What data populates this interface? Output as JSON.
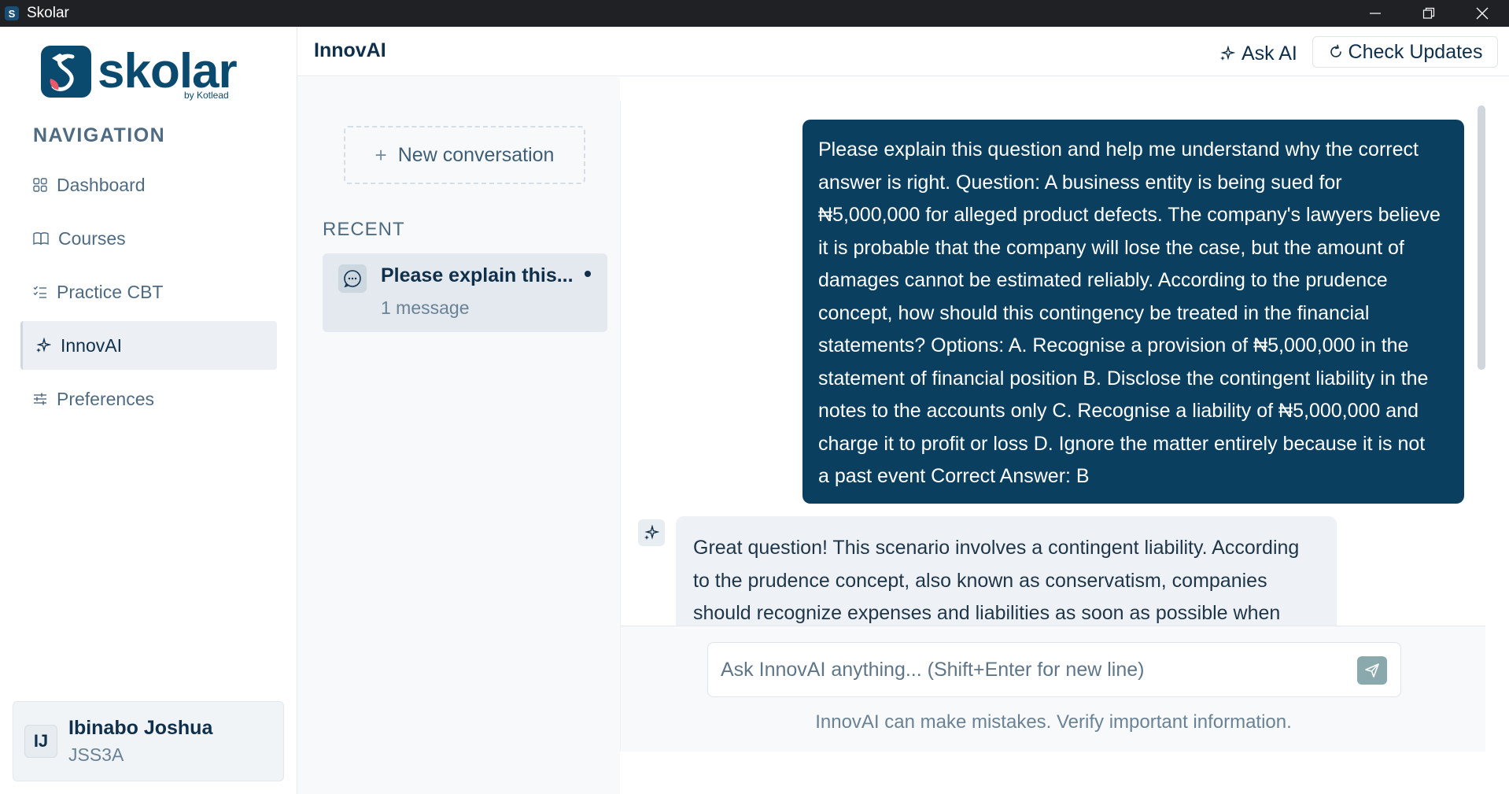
{
  "window": {
    "title": "Skolar",
    "app_icon": "skolar-logo-icon"
  },
  "sidebar": {
    "logo_word": "skolar",
    "logo_by": "by Kotlead",
    "nav_heading": "NAVIGATION",
    "items": [
      {
        "label": "Dashboard",
        "icon": "grid-icon",
        "active": false
      },
      {
        "label": "Courses",
        "icon": "book-icon",
        "active": false
      },
      {
        "label": "Practice CBT",
        "icon": "checklist-icon",
        "active": false
      },
      {
        "label": "InnovAI",
        "icon": "sparkle-icon",
        "active": true
      },
      {
        "label": "Preferences",
        "icon": "sliders-icon",
        "active": false
      }
    ],
    "user": {
      "initials": "IJ",
      "name": "Ibinabo Joshua",
      "class": "JSS3A"
    }
  },
  "header": {
    "title": "InnovAI",
    "ask_ai_label": "Ask AI",
    "check_updates_label": "Check Updates"
  },
  "conversations": {
    "new_label": "New conversation",
    "recent_heading": "RECENT",
    "items": [
      {
        "title": "Please explain this...",
        "subtitle": "1 message",
        "unread": true
      }
    ]
  },
  "chat": {
    "messages": [
      {
        "role": "user",
        "lines": [
          "Please explain this question and help me understand why the correct",
          "answer is right. Question: A business entity is being sued for",
          "₦5,000,000 for alleged product defects. The company's lawyers believe",
          "it is probable that the company will lose the case, but the amount of",
          "damages cannot be estimated reliably. According to the prudence",
          "concept, how should this contingency be treated in the financial",
          "statements? Options: A. Recognise a provision of ₦5,000,000 in the",
          "statement of financial position B. Disclose the contingent liability in the",
          "notes to the accounts only C. Recognise a liability of ₦5,000,000 and",
          "charge it to profit or loss D. Ignore the matter entirely because it is not",
          "a past event Correct Answer: B"
        ]
      },
      {
        "role": "assistant",
        "lines": [
          "Great question! This scenario involves a contingent liability. According",
          "to the prudence concept, also known as conservatism, companies",
          "should recognize expenses and liabilities as soon as possible when"
        ]
      }
    ],
    "input_placeholder": "Ask InnovAI anything... (Shift+Enter for new line)",
    "disclaimer": "InnovAI can make mistakes. Verify important information."
  },
  "colors": {
    "brand": "#0b4a6f",
    "user_bubble": "#0b3f5f",
    "ai_bubble": "#eef2f6",
    "send_button": "#8aa9ad"
  }
}
